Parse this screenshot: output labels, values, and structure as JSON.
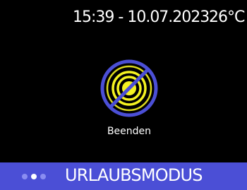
{
  "status_bar": {
    "datetime": "15:39 - 10.07.2023",
    "temperature": "26°C"
  },
  "main": {
    "end_button": {
      "label": "Beenden",
      "icon": "disabled-sun-icon"
    }
  },
  "bottom_bar": {
    "title": "URLAUBSMODUS",
    "pages": {
      "count": 3,
      "active_index": 1
    }
  },
  "colors": {
    "background": "#000000",
    "accent": "#4b4fd6",
    "sun": "#f4f221",
    "text": "#ffffff"
  }
}
